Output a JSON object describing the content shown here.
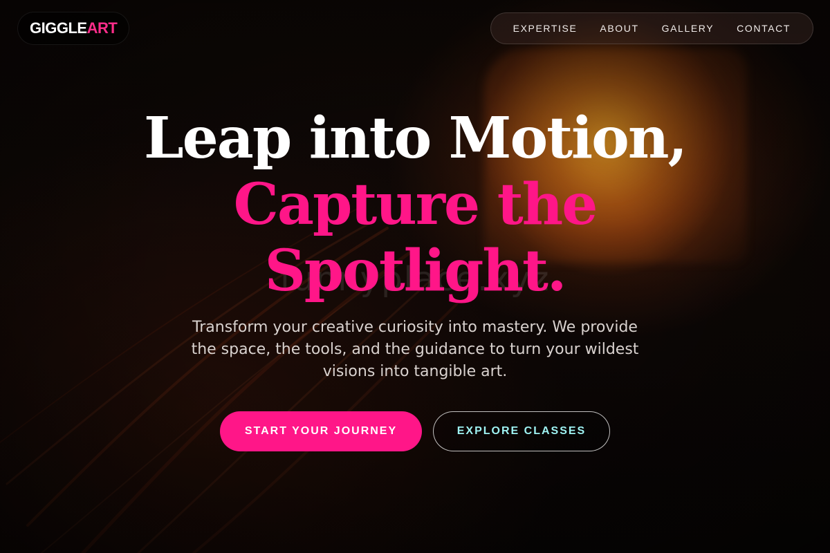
{
  "header": {
    "logo": {
      "part1": "GIGGLE",
      "part2": "ART"
    },
    "nav": [
      {
        "label": "EXPERTISE"
      },
      {
        "label": "ABOUT"
      },
      {
        "label": "GALLERY"
      },
      {
        "label": "CONTACT"
      }
    ]
  },
  "hero": {
    "title_line1": "Leap into Motion,",
    "title_line2": "Capture the",
    "title_line3": "Spotlight.",
    "subtitle": "Transform your creative curiosity into mastery. We provide the space, the tools, and the guidance to turn your wildest visions into tangible art.",
    "primary_cta": "START YOUR JOURNEY",
    "secondary_cta": "EXPLORE CLASSES",
    "watermark": "funnyplace.xyz"
  },
  "colors": {
    "accent": "#ff1688",
    "secondary_cta_text": "#9ff3f3",
    "background": "#0b0706"
  }
}
